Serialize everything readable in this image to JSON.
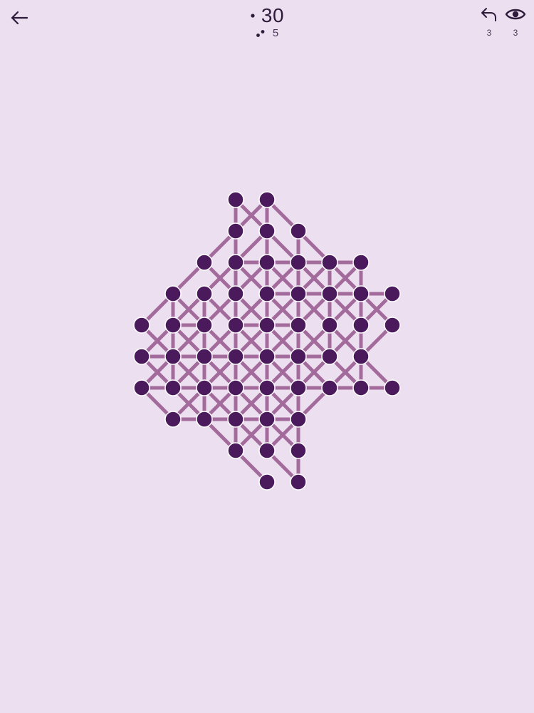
{
  "header": {
    "moves": "30",
    "level": "5",
    "undo_count": "3",
    "hint_count": "3"
  },
  "colors": {
    "background": "#ece0f0",
    "dot": "#4a1a5c",
    "line": "#a36a9c",
    "dot_outline": "#ffffff"
  },
  "icons": [
    "back-arrow-icon",
    "single-dot-icon",
    "two-dots-icon",
    "undo-icon",
    "eye-icon"
  ],
  "board": {
    "dots": [
      [
        3,
        0
      ],
      [
        4,
        0
      ],
      [
        3,
        1
      ],
      [
        4,
        1
      ],
      [
        5,
        1
      ],
      [
        2,
        2
      ],
      [
        3,
        2
      ],
      [
        4,
        2
      ],
      [
        5,
        2
      ],
      [
        6,
        2
      ],
      [
        7,
        2
      ],
      [
        1,
        3
      ],
      [
        2,
        3
      ],
      [
        3,
        3
      ],
      [
        4,
        3
      ],
      [
        5,
        3
      ],
      [
        6,
        3
      ],
      [
        7,
        3
      ],
      [
        8,
        3
      ],
      [
        0,
        4
      ],
      [
        1,
        4
      ],
      [
        2,
        4
      ],
      [
        3,
        4
      ],
      [
        4,
        4
      ],
      [
        5,
        4
      ],
      [
        6,
        4
      ],
      [
        7,
        4
      ],
      [
        8,
        4
      ],
      [
        0,
        5
      ],
      [
        1,
        5
      ],
      [
        2,
        5
      ],
      [
        3,
        5
      ],
      [
        4,
        5
      ],
      [
        5,
        5
      ],
      [
        6,
        5
      ],
      [
        7,
        5
      ],
      [
        0,
        6
      ],
      [
        1,
        6
      ],
      [
        2,
        6
      ],
      [
        3,
        6
      ],
      [
        4,
        6
      ],
      [
        5,
        6
      ],
      [
        6,
        6
      ],
      [
        7,
        6
      ],
      [
        8,
        6
      ],
      [
        1,
        7
      ],
      [
        2,
        7
      ],
      [
        3,
        7
      ],
      [
        4,
        7
      ],
      [
        5,
        7
      ],
      [
        3,
        8
      ],
      [
        4,
        8
      ],
      [
        5,
        8
      ],
      [
        4,
        9
      ],
      [
        5,
        9
      ]
    ],
    "lines": [
      [
        [
          3,
          0
        ],
        [
          3,
          1
        ]
      ],
      [
        [
          4,
          0
        ],
        [
          4,
          1
        ]
      ],
      [
        [
          3,
          0
        ],
        [
          4,
          1
        ]
      ],
      [
        [
          4,
          0
        ],
        [
          3,
          1
        ]
      ],
      [
        [
          4,
          0
        ],
        [
          5,
          1
        ]
      ],
      [
        [
          3,
          1
        ],
        [
          2,
          2
        ]
      ],
      [
        [
          3,
          1
        ],
        [
          3,
          2
        ]
      ],
      [
        [
          4,
          1
        ],
        [
          4,
          2
        ]
      ],
      [
        [
          4,
          1
        ],
        [
          5,
          2
        ]
      ],
      [
        [
          5,
          1
        ],
        [
          5,
          2
        ]
      ],
      [
        [
          5,
          1
        ],
        [
          6,
          2
        ]
      ],
      [
        [
          4,
          1
        ],
        [
          3,
          2
        ]
      ],
      [
        [
          2,
          2
        ],
        [
          1,
          3
        ]
      ],
      [
        [
          3,
          2
        ],
        [
          4,
          2
        ]
      ],
      [
        [
          4,
          2
        ],
        [
          5,
          2
        ]
      ],
      [
        [
          5,
          2
        ],
        [
          6,
          2
        ]
      ],
      [
        [
          6,
          2
        ],
        [
          7,
          2
        ]
      ],
      [
        [
          2,
          2
        ],
        [
          3,
          3
        ]
      ],
      [
        [
          3,
          2
        ],
        [
          4,
          3
        ]
      ],
      [
        [
          4,
          2
        ],
        [
          5,
          3
        ]
      ],
      [
        [
          5,
          2
        ],
        [
          6,
          3
        ]
      ],
      [
        [
          6,
          2
        ],
        [
          7,
          3
        ]
      ],
      [
        [
          3,
          2
        ],
        [
          2,
          3
        ]
      ],
      [
        [
          4,
          2
        ],
        [
          3,
          3
        ]
      ],
      [
        [
          5,
          2
        ],
        [
          4,
          3
        ]
      ],
      [
        [
          6,
          2
        ],
        [
          5,
          3
        ]
      ],
      [
        [
          7,
          2
        ],
        [
          6,
          3
        ]
      ],
      [
        [
          3,
          2
        ],
        [
          3,
          3
        ]
      ],
      [
        [
          4,
          2
        ],
        [
          4,
          3
        ]
      ],
      [
        [
          5,
          2
        ],
        [
          5,
          3
        ]
      ],
      [
        [
          6,
          2
        ],
        [
          6,
          3
        ]
      ],
      [
        [
          7,
          2
        ],
        [
          7,
          3
        ]
      ],
      [
        [
          1,
          3
        ],
        [
          0,
          4
        ]
      ],
      [
        [
          1,
          3
        ],
        [
          1,
          4
        ]
      ],
      [
        [
          1,
          3
        ],
        [
          2,
          4
        ]
      ],
      [
        [
          2,
          3
        ],
        [
          1,
          4
        ]
      ],
      [
        [
          2,
          3
        ],
        [
          2,
          4
        ]
      ],
      [
        [
          2,
          3
        ],
        [
          3,
          4
        ]
      ],
      [
        [
          3,
          3
        ],
        [
          2,
          4
        ]
      ],
      [
        [
          3,
          3
        ],
        [
          3,
          4
        ]
      ],
      [
        [
          3,
          3
        ],
        [
          4,
          4
        ]
      ],
      [
        [
          4,
          3
        ],
        [
          3,
          4
        ]
      ],
      [
        [
          4,
          3
        ],
        [
          4,
          4
        ]
      ],
      [
        [
          4,
          3
        ],
        [
          5,
          4
        ]
      ],
      [
        [
          5,
          3
        ],
        [
          4,
          4
        ]
      ],
      [
        [
          5,
          3
        ],
        [
          5,
          4
        ]
      ],
      [
        [
          5,
          3
        ],
        [
          6,
          4
        ]
      ],
      [
        [
          6,
          3
        ],
        [
          5,
          4
        ]
      ],
      [
        [
          6,
          3
        ],
        [
          6,
          4
        ]
      ],
      [
        [
          6,
          3
        ],
        [
          7,
          4
        ]
      ],
      [
        [
          7,
          3
        ],
        [
          6,
          4
        ]
      ],
      [
        [
          7,
          3
        ],
        [
          7,
          4
        ]
      ],
      [
        [
          7,
          3
        ],
        [
          8,
          4
        ]
      ],
      [
        [
          8,
          3
        ],
        [
          7,
          4
        ]
      ],
      [
        [
          4,
          3
        ],
        [
          5,
          3
        ]
      ],
      [
        [
          5,
          3
        ],
        [
          6,
          3
        ]
      ],
      [
        [
          6,
          3
        ],
        [
          7,
          3
        ]
      ],
      [
        [
          7,
          3
        ],
        [
          8,
          3
        ]
      ],
      [
        [
          1,
          4
        ],
        [
          2,
          4
        ]
      ],
      [
        [
          3,
          4
        ],
        [
          4,
          4
        ]
      ],
      [
        [
          4,
          4
        ],
        [
          5,
          4
        ]
      ],
      [
        [
          0,
          4
        ],
        [
          1,
          5
        ]
      ],
      [
        [
          1,
          4
        ],
        [
          0,
          5
        ]
      ],
      [
        [
          1,
          4
        ],
        [
          1,
          5
        ]
      ],
      [
        [
          1,
          4
        ],
        [
          2,
          5
        ]
      ],
      [
        [
          2,
          4
        ],
        [
          1,
          5
        ]
      ],
      [
        [
          2,
          4
        ],
        [
          2,
          5
        ]
      ],
      [
        [
          2,
          4
        ],
        [
          3,
          5
        ]
      ],
      [
        [
          3,
          4
        ],
        [
          2,
          5
        ]
      ],
      [
        [
          3,
          4
        ],
        [
          3,
          5
        ]
      ],
      [
        [
          3,
          4
        ],
        [
          4,
          5
        ]
      ],
      [
        [
          4,
          4
        ],
        [
          3,
          5
        ]
      ],
      [
        [
          4,
          4
        ],
        [
          4,
          5
        ]
      ],
      [
        [
          4,
          4
        ],
        [
          5,
          5
        ]
      ],
      [
        [
          5,
          4
        ],
        [
          4,
          5
        ]
      ],
      [
        [
          5,
          4
        ],
        [
          5,
          5
        ]
      ],
      [
        [
          5,
          4
        ],
        [
          6,
          5
        ]
      ],
      [
        [
          6,
          4
        ],
        [
          5,
          5
        ]
      ],
      [
        [
          6,
          4
        ],
        [
          6,
          5
        ]
      ],
      [
        [
          6,
          4
        ],
        [
          7,
          5
        ]
      ],
      [
        [
          7,
          4
        ],
        [
          6,
          5
        ]
      ],
      [
        [
          7,
          4
        ],
        [
          7,
          5
        ]
      ],
      [
        [
          8,
          4
        ],
        [
          7,
          5
        ]
      ],
      [
        [
          0,
          5
        ],
        [
          1,
          5
        ]
      ],
      [
        [
          1,
          5
        ],
        [
          2,
          5
        ]
      ],
      [
        [
          2,
          5
        ],
        [
          3,
          5
        ]
      ],
      [
        [
          3,
          5
        ],
        [
          4,
          5
        ]
      ],
      [
        [
          4,
          5
        ],
        [
          5,
          5
        ]
      ],
      [
        [
          5,
          5
        ],
        [
          6,
          5
        ]
      ],
      [
        [
          0,
          5
        ],
        [
          1,
          6
        ]
      ],
      [
        [
          1,
          5
        ],
        [
          0,
          6
        ]
      ],
      [
        [
          1,
          5
        ],
        [
          1,
          6
        ]
      ],
      [
        [
          1,
          5
        ],
        [
          2,
          6
        ]
      ],
      [
        [
          2,
          5
        ],
        [
          1,
          6
        ]
      ],
      [
        [
          2,
          5
        ],
        [
          2,
          6
        ]
      ],
      [
        [
          2,
          5
        ],
        [
          3,
          6
        ]
      ],
      [
        [
          3,
          5
        ],
        [
          2,
          6
        ]
      ],
      [
        [
          3,
          5
        ],
        [
          3,
          6
        ]
      ],
      [
        [
          3,
          5
        ],
        [
          4,
          6
        ]
      ],
      [
        [
          4,
          5
        ],
        [
          3,
          6
        ]
      ],
      [
        [
          4,
          5
        ],
        [
          4,
          6
        ]
      ],
      [
        [
          4,
          5
        ],
        [
          5,
          6
        ]
      ],
      [
        [
          5,
          5
        ],
        [
          4,
          6
        ]
      ],
      [
        [
          5,
          5
        ],
        [
          5,
          6
        ]
      ],
      [
        [
          5,
          5
        ],
        [
          6,
          6
        ]
      ],
      [
        [
          6,
          5
        ],
        [
          5,
          6
        ]
      ],
      [
        [
          6,
          5
        ],
        [
          7,
          6
        ]
      ],
      [
        [
          7,
          5
        ],
        [
          6,
          6
        ]
      ],
      [
        [
          7,
          5
        ],
        [
          7,
          6
        ]
      ],
      [
        [
          7,
          5
        ],
        [
          8,
          6
        ]
      ],
      [
        [
          0,
          6
        ],
        [
          1,
          6
        ]
      ],
      [
        [
          1,
          6
        ],
        [
          2,
          6
        ]
      ],
      [
        [
          2,
          6
        ],
        [
          3,
          6
        ]
      ],
      [
        [
          3,
          6
        ],
        [
          4,
          6
        ]
      ],
      [
        [
          4,
          6
        ],
        [
          5,
          6
        ]
      ],
      [
        [
          5,
          6
        ],
        [
          6,
          6
        ]
      ],
      [
        [
          6,
          6
        ],
        [
          7,
          6
        ]
      ],
      [
        [
          7,
          6
        ],
        [
          8,
          6
        ]
      ],
      [
        [
          0,
          6
        ],
        [
          1,
          7
        ]
      ],
      [
        [
          1,
          6
        ],
        [
          2,
          7
        ]
      ],
      [
        [
          2,
          6
        ],
        [
          1,
          7
        ]
      ],
      [
        [
          2,
          6
        ],
        [
          2,
          7
        ]
      ],
      [
        [
          2,
          6
        ],
        [
          3,
          7
        ]
      ],
      [
        [
          3,
          6
        ],
        [
          2,
          7
        ]
      ],
      [
        [
          3,
          6
        ],
        [
          3,
          7
        ]
      ],
      [
        [
          3,
          6
        ],
        [
          4,
          7
        ]
      ],
      [
        [
          4,
          6
        ],
        [
          3,
          7
        ]
      ],
      [
        [
          4,
          6
        ],
        [
          4,
          7
        ]
      ],
      [
        [
          4,
          6
        ],
        [
          5,
          7
        ]
      ],
      [
        [
          5,
          6
        ],
        [
          4,
          7
        ]
      ],
      [
        [
          5,
          6
        ],
        [
          5,
          7
        ]
      ],
      [
        [
          6,
          6
        ],
        [
          5,
          7
        ]
      ],
      [
        [
          1,
          7
        ],
        [
          2,
          7
        ]
      ],
      [
        [
          2,
          7
        ],
        [
          3,
          7
        ]
      ],
      [
        [
          3,
          7
        ],
        [
          4,
          7
        ]
      ],
      [
        [
          4,
          7
        ],
        [
          5,
          7
        ]
      ],
      [
        [
          2,
          7
        ],
        [
          3,
          8
        ]
      ],
      [
        [
          3,
          7
        ],
        [
          3,
          8
        ]
      ],
      [
        [
          3,
          7
        ],
        [
          4,
          8
        ]
      ],
      [
        [
          4,
          7
        ],
        [
          3,
          8
        ]
      ],
      [
        [
          4,
          7
        ],
        [
          4,
          8
        ]
      ],
      [
        [
          4,
          7
        ],
        [
          5,
          8
        ]
      ],
      [
        [
          5,
          7
        ],
        [
          4,
          8
        ]
      ],
      [
        [
          5,
          7
        ],
        [
          5,
          8
        ]
      ],
      [
        [
          3,
          8
        ],
        [
          4,
          9
        ]
      ],
      [
        [
          4,
          8
        ],
        [
          5,
          9
        ]
      ],
      [
        [
          5,
          8
        ],
        [
          5,
          9
        ]
      ]
    ]
  }
}
